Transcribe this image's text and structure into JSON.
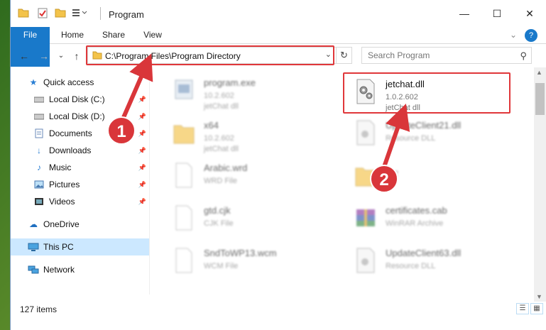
{
  "window": {
    "title": "Program",
    "controls": {
      "minimize": "—",
      "maximize": "☐",
      "close": "✕"
    }
  },
  "ribbon": {
    "tabs": [
      {
        "label": "File",
        "active": true
      },
      {
        "label": "Home"
      },
      {
        "label": "Share"
      },
      {
        "label": "View"
      }
    ],
    "help_icon": "?"
  },
  "navigation": {
    "back": "←",
    "forward": "→",
    "recent": "⌄",
    "up": "↑"
  },
  "address_bar": {
    "path": "C:\\Program Files\\Program Directory",
    "dropdown": "⌄",
    "refresh": "↻"
  },
  "search": {
    "placeholder": "Search Program",
    "icon": "search-icon"
  },
  "sidebar": {
    "items": [
      {
        "label": "Quick access",
        "icon": "star-icon",
        "pinned": false
      },
      {
        "label": "Local Disk (C:)",
        "icon": "drive-icon",
        "pinned": true
      },
      {
        "label": "Local Disk (D:)",
        "icon": "drive-icon",
        "pinned": true
      },
      {
        "label": "Documents",
        "icon": "documents-icon",
        "pinned": true
      },
      {
        "label": "Downloads",
        "icon": "download-icon",
        "pinned": true
      },
      {
        "label": "Music",
        "icon": "music-icon",
        "pinned": true
      },
      {
        "label": "Pictures",
        "icon": "pictures-icon",
        "pinned": true
      },
      {
        "label": "Videos",
        "icon": "videos-icon",
        "pinned": true
      },
      {
        "label": "OneDrive",
        "icon": "cloud-icon",
        "pinned": false
      },
      {
        "label": "This PC",
        "icon": "computer-icon",
        "pinned": false,
        "selected": true
      },
      {
        "label": "Network",
        "icon": "network-icon",
        "pinned": false
      }
    ]
  },
  "files": [
    {
      "name": "program.exe",
      "line2": "10.2.602",
      "line3": "jetChat dll",
      "icon": "exe-icon",
      "blurred": true
    },
    {
      "name": "jetchat.dll",
      "line2": "1.0.2.602",
      "line3": "jetChat dll",
      "icon": "dll-gear-icon",
      "blurred": false,
      "highlighted": true
    },
    {
      "name": "x64",
      "line2": "10.2.602",
      "line3": "jetChat dll",
      "icon": "folder-icon",
      "blurred": true
    },
    {
      "name": "UpdateClient21.dll",
      "line2": "Resource DLL",
      "line3": "",
      "icon": "dll-icon",
      "blurred": true
    },
    {
      "name": "Arabic.wrd",
      "line2": "WRD File",
      "line3": "",
      "icon": "blank-file-icon",
      "blurred": true
    },
    {
      "name": "",
      "line2": "602",
      "line3": "",
      "icon": "folder-icon",
      "blurred": true
    },
    {
      "name": "gtd.cjk",
      "line2": "CJK File",
      "line3": "",
      "icon": "blank-file-icon",
      "blurred": true
    },
    {
      "name": "certificates.cab",
      "line2": "WinRAR Archive",
      "line3": "",
      "icon": "archive-icon",
      "blurred": true
    },
    {
      "name": "SndToWP13.wcm",
      "line2": "WCM File",
      "line3": "",
      "icon": "blank-file-icon",
      "blurred": true
    },
    {
      "name": "UpdateClient63.dll",
      "line2": "Resource DLL",
      "line3": "",
      "icon": "dll-icon",
      "blurred": true
    }
  ],
  "status_bar": {
    "item_count": "127 items"
  },
  "annotations": [
    {
      "label": "1"
    },
    {
      "label": "2"
    }
  ],
  "colors": {
    "accent": "#1979ca",
    "highlight_box": "#e0373a",
    "badge": "#d9363a",
    "selected_nav": "#cce8ff"
  }
}
